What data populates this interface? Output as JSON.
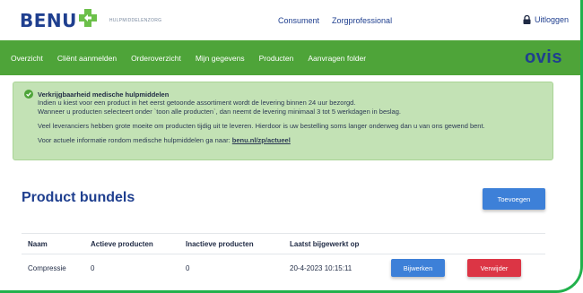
{
  "header": {
    "logo_text": "BENU",
    "logo_subtitle": "HULPMIDDELENZORG",
    "links": [
      "Consument",
      "Zorgprofessional"
    ],
    "logout_label": "Uitloggen",
    "icons": {
      "logo": "benu-cross-icon",
      "logout": "lock-icon"
    }
  },
  "nav": {
    "items": [
      "Overzicht",
      "Cliënt aanmelden",
      "Orderoverzicht",
      "Mijn gegevens",
      "Producten",
      "Aanvragen folder"
    ],
    "brand": "ovis"
  },
  "alert": {
    "title": "Verkrijgbaarheid medische hulpmiddelen",
    "line1": "Indien u kiest voor een product in het eerst getoonde assortiment wordt de levering binnen 24 uur bezorgd.",
    "line2": "Wanneer u producten selecteert onder `toon alle producten`, dan neemt de levering minimaal 3 tot 5 werkdagen in beslag.",
    "line3": "Veel leveranciers hebben grote moeite om producten tijdig uit te leveren. Hierdoor is uw bestelling soms langer onderweg dan u van ons gewend bent.",
    "line4_prefix": "Voor actuele informatie rondom medische hulpmiddelen ga naar: ",
    "line4_link": "benu.nl/zp/actueel",
    "icon": "check-circle-icon"
  },
  "main": {
    "title": "Product bundels",
    "add_label": "Toevoegen"
  },
  "table": {
    "headers": [
      "Naam",
      "Actieve producten",
      "Inactieve producten",
      "Laatst bijgewerkt op"
    ],
    "rows": [
      {
        "name": "Compressie",
        "active": "0",
        "inactive": "0",
        "updated": "20-4-2023 10:15:11",
        "edit_label": "Bijwerken",
        "delete_label": "Verwijder"
      }
    ]
  },
  "colors": {
    "nav_bg": "#4ea439",
    "brand_blue": "#1f3f8f",
    "alert_bg": "#c3e2b5",
    "button_blue": "#3d80d8",
    "button_red": "#dc3545",
    "frame_green": "#22b14c"
  }
}
